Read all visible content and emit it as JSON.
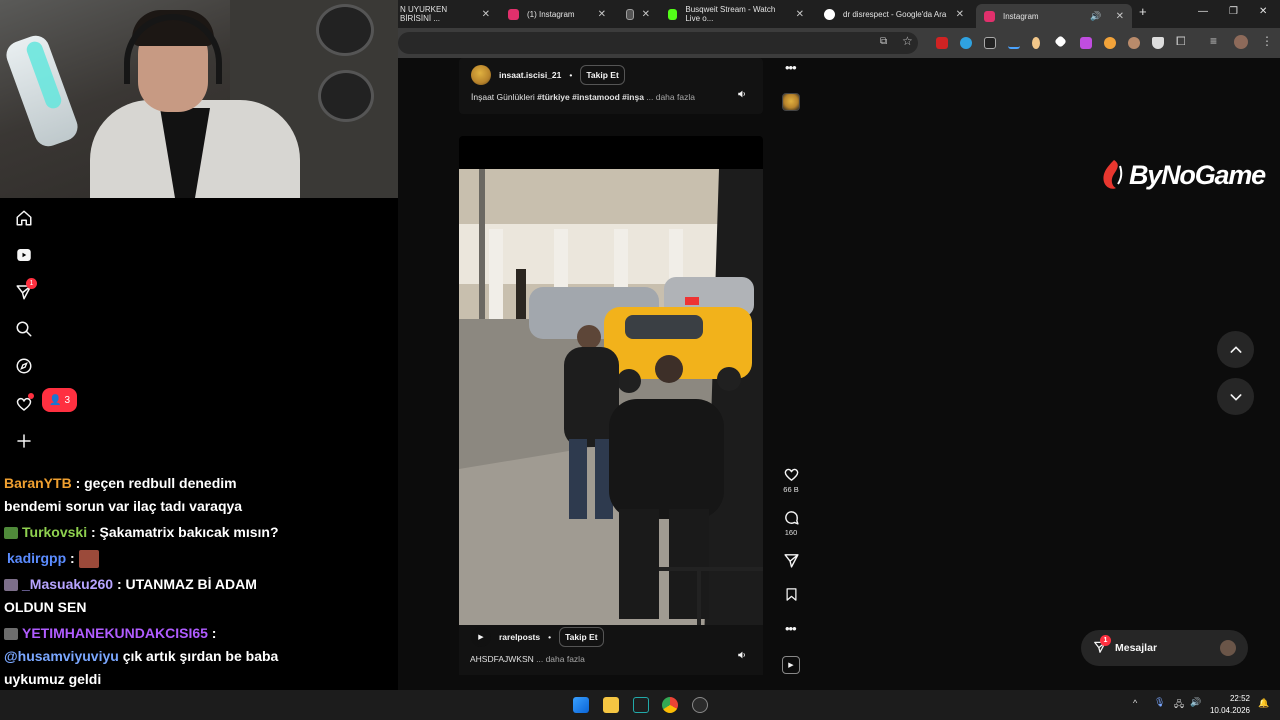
{
  "browser": {
    "tabs": [
      {
        "title": "N UYURKEN BİRİSİNİ ...",
        "favicon_color": "#1f1f1f"
      },
      {
        "title": "(1) Instagram",
        "favicon_color": "#e1306c"
      },
      {
        "title": "",
        "favicon_color": "#9e9e9e"
      },
      {
        "title": "Busqweit Stream - Watch Live o...",
        "favicon_color": "#53fc18"
      },
      {
        "title": "dr disrespect - Google'da Ara",
        "favicon_color": "#4285f4"
      },
      {
        "title": "Instagram",
        "favicon_color": "#e1306c"
      }
    ],
    "new_tab_label": "+"
  },
  "sidebar": {
    "notifications_badge": "1",
    "follow_requests_count": "3"
  },
  "chat": [
    {
      "user": "BaranYTB",
      "color": "#f0a030",
      "message": " : geçen redbull denedim bendemi sorun var ilaç tadı varaqya"
    },
    {
      "user": "Turkovski",
      "color": "#8fd14f",
      "message": " : Şakamatrix bakıcak mısın?"
    },
    {
      "user": "kadirgpp",
      "color": "#5b8cff",
      "message": " : "
    },
    {
      "user": "_Masuaku260",
      "color": "#b7a4ff",
      "message": " : UTANMAZ Bİ ADAM OLDUN SEN"
    },
    {
      "user": "YETIMHANEKUNDAKCISI65",
      "color": "#b05cff",
      "message": " : "
    },
    {
      "user": "@husamviyuviyu",
      "color": "#7aa7ff",
      "message": " çık artık şırdan be baba uykumuz geldi"
    }
  ],
  "post1": {
    "username": "insaat.iscisi_21",
    "follow_label": "Takip Et",
    "caption": "İnşaat Günlükleri ",
    "tags": "#türkiye #instamood #inşa",
    "more": " ... daha fazla"
  },
  "post2": {
    "username": "rarelposts",
    "follow_label": "Takip Et",
    "caption": "AHSDFAJWKSN",
    "more": " ... daha fazla"
  },
  "actions": {
    "likes": "66 B",
    "comments": "160"
  },
  "messages": {
    "label": "Mesajlar",
    "badge": "1"
  },
  "logo": {
    "text": "ByNoGame"
  },
  "taskbar": {
    "time": "22:52",
    "date": "10.04.2026"
  }
}
